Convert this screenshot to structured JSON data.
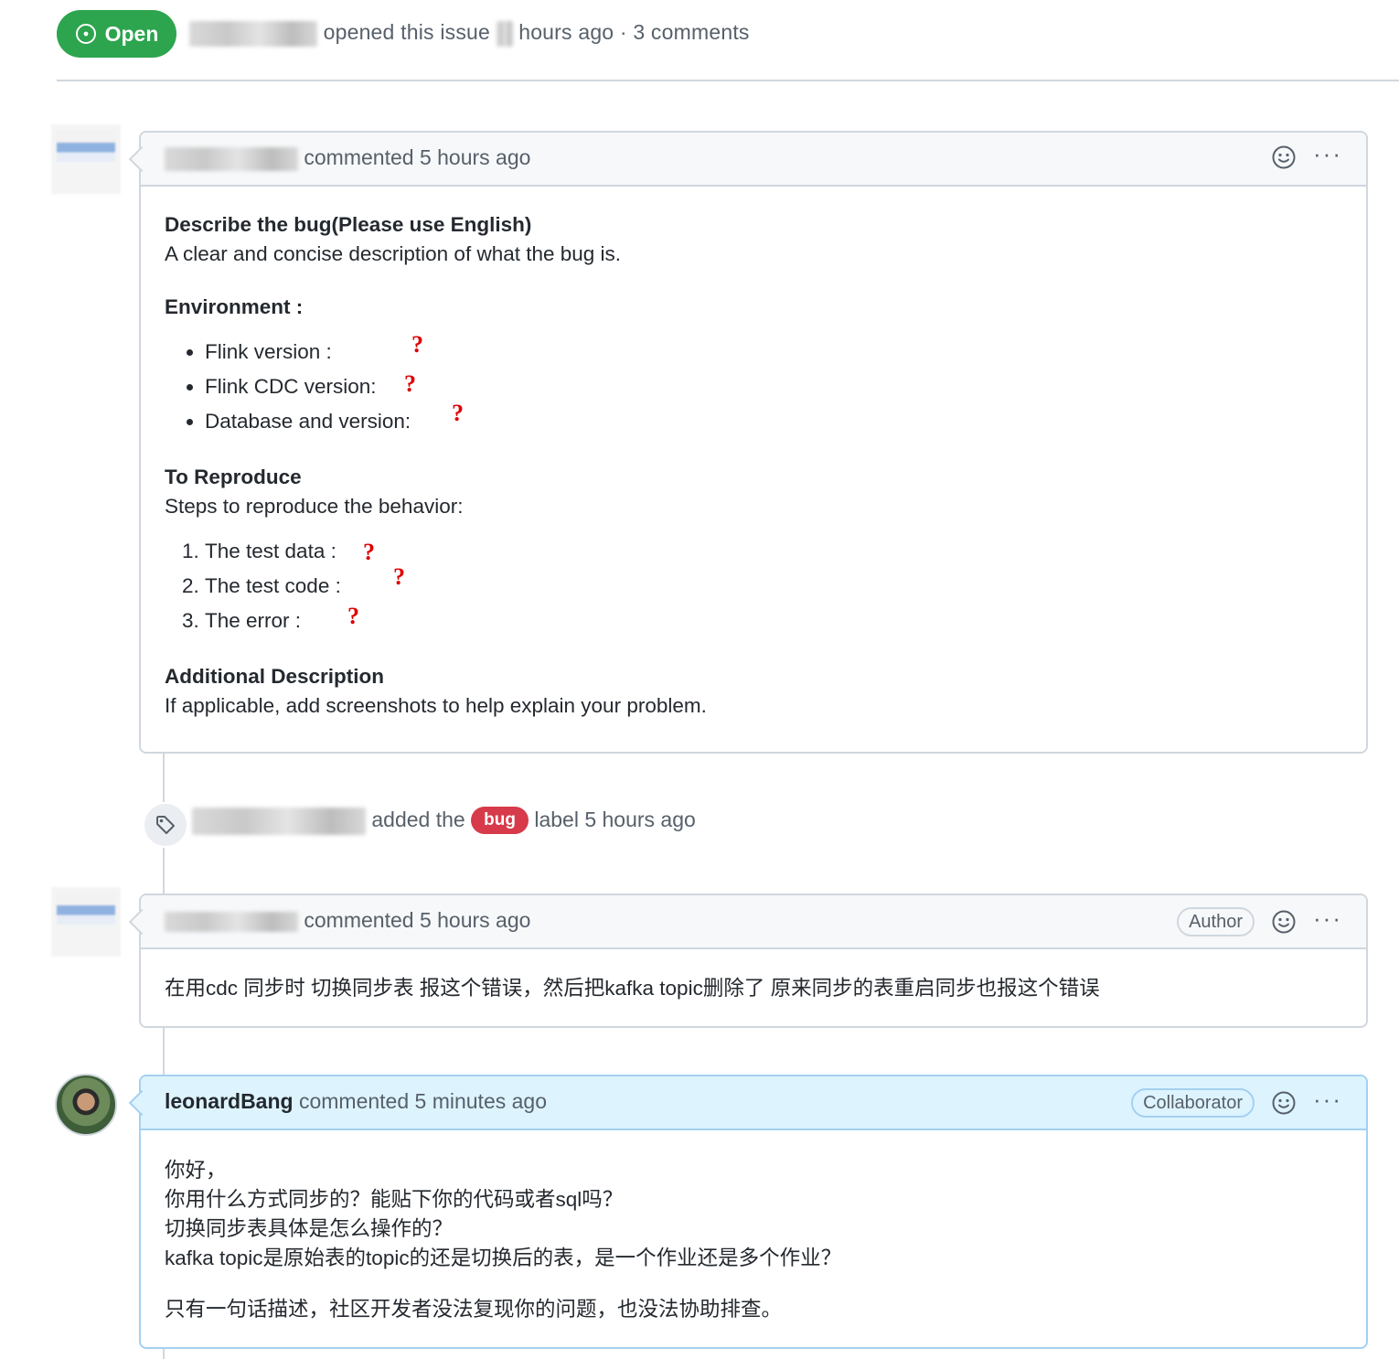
{
  "issue": {
    "state": "Open",
    "opened_text": "opened this issue",
    "hours_ago": "hours ago",
    "comment_count": "· 3 comments"
  },
  "comment1": {
    "action": "commented 5 hours ago",
    "h_describe": "Describe the bug(Please use English)",
    "p_describe": "A clear and concise description of what the bug is.",
    "h_env": "Environment :",
    "env_items": [
      "Flink version :",
      "Flink CDC version:",
      "Database and version:"
    ],
    "h_repro": "To Reproduce",
    "p_repro": "Steps to reproduce the behavior:",
    "repro_items": [
      "The test data :",
      "The test code :",
      "The error :"
    ],
    "h_additional": "Additional Description",
    "p_additional": "If applicable, add screenshots to help explain your problem.",
    "annotation_mark": "?"
  },
  "label_event": {
    "action": "added the",
    "label": "bug",
    "suffix": "label 5 hours ago"
  },
  "comment2": {
    "action": "commented 5 hours ago",
    "role": "Author",
    "body": "在用cdc 同步时 切换同步表 报这个错误，然后把kafka topic删除了 原来同步的表重启同步也报这个错误"
  },
  "comment3": {
    "author": "leonardBang",
    "action": "commented 5 minutes ago",
    "role": "Collaborator",
    "lines": [
      "你好，",
      "你用什么方式同步的？能贴下你的代码或者sql吗？",
      "切换同步表具体是怎么操作的？",
      "kafka topic是原始表的topic的还是切换后的表，是一个作业还是多个作业？"
    ],
    "closing": "只有一句话描述，社区开发者没法复现你的问题，也没法协助排查。"
  },
  "icons": {
    "state": "issue-opened-icon",
    "reaction": "smiley-icon",
    "menu": "kebab-horizontal-icon",
    "label": "tag-icon"
  },
  "colors": {
    "open_green": "#2da44e",
    "bug_red": "#d73a4a",
    "annotation_red": "#e00000",
    "collaborator_header": "#ddf4ff"
  }
}
